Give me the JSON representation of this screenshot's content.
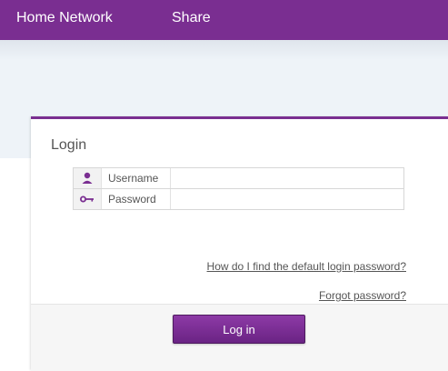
{
  "nav": {
    "home_label": "Home Network",
    "share_label": "Share"
  },
  "login": {
    "title": "Login",
    "username_label": "Username",
    "password_label": "Password",
    "username_value": "",
    "password_value": "",
    "default_password_link": "How do I find the default login password?",
    "forgot_password_link": "Forgot password?",
    "submit_label": "Log in"
  },
  "colors": {
    "brand": "#7a2e91",
    "button": "#7a2e91"
  },
  "icons": {
    "username": "user-icon",
    "password": "key-icon"
  }
}
